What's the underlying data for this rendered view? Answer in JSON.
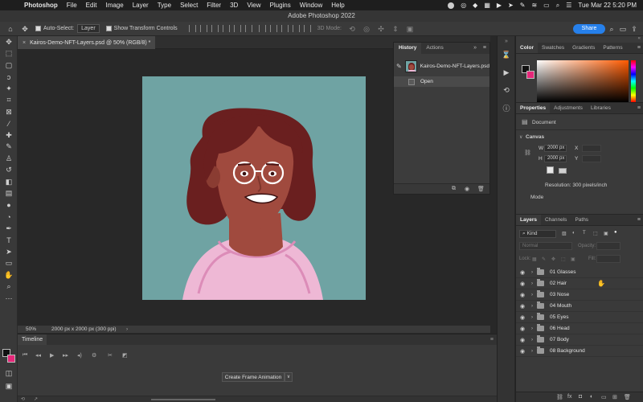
{
  "menubar": {
    "app_name": "Photoshop",
    "items": [
      "File",
      "Edit",
      "Image",
      "Layer",
      "Type",
      "Select",
      "Filter",
      "3D",
      "View",
      "Plugins",
      "Window",
      "Help"
    ],
    "datetime": "Tue Mar 22  5:20 PM"
  },
  "window_title": "Adobe Photoshop 2022",
  "options": {
    "auto_select_label": "Auto-Select:",
    "auto_select_value": "Layer",
    "show_transform_label": "Show Transform Controls",
    "three_d_mode": "3D Mode:",
    "share_label": "Share"
  },
  "document": {
    "tab_title": "Kairos-Demo-NFT-Layers.psd @ 50% (RGB/8) *",
    "zoom": "50%",
    "dimensions": "2000 px x 2000 px (300 ppi)"
  },
  "timeline": {
    "title": "Timeline",
    "create_frame_label": "Create Frame Animation"
  },
  "history": {
    "tabs": [
      "History",
      "Actions"
    ],
    "snapshot": "Kairos-Demo-NFT-Layers.psd",
    "steps": [
      "Open"
    ]
  },
  "color_panel": {
    "tabs": [
      "Color",
      "Swatches",
      "Gradients",
      "Patterns"
    ],
    "foreground": "#111111",
    "background": "#e6287a"
  },
  "properties": {
    "tabs": [
      "Properties",
      "Adjustments",
      "Libraries"
    ],
    "type_label": "Document",
    "canvas_label": "Canvas",
    "w_label": "W",
    "w_value": "2000 px",
    "h_label": "H",
    "h_value": "2000 px",
    "x_label": "X",
    "y_label": "Y",
    "resolution": "Resolution: 300 pixels/inch",
    "mode_label": "Mode"
  },
  "layers": {
    "tabs": [
      "Layers",
      "Channels",
      "Paths"
    ],
    "filter_kind": "Kind",
    "blend_mode": "Normal",
    "opacity_label": "Opacity:",
    "lock_label": "Lock:",
    "fill_label": "Fill:",
    "items": [
      "01 Glasses",
      "02 Hair",
      "03 Nose",
      "04 Mouth",
      "05 Eyes",
      "06 Head",
      "07 Body",
      "08 Background"
    ]
  }
}
